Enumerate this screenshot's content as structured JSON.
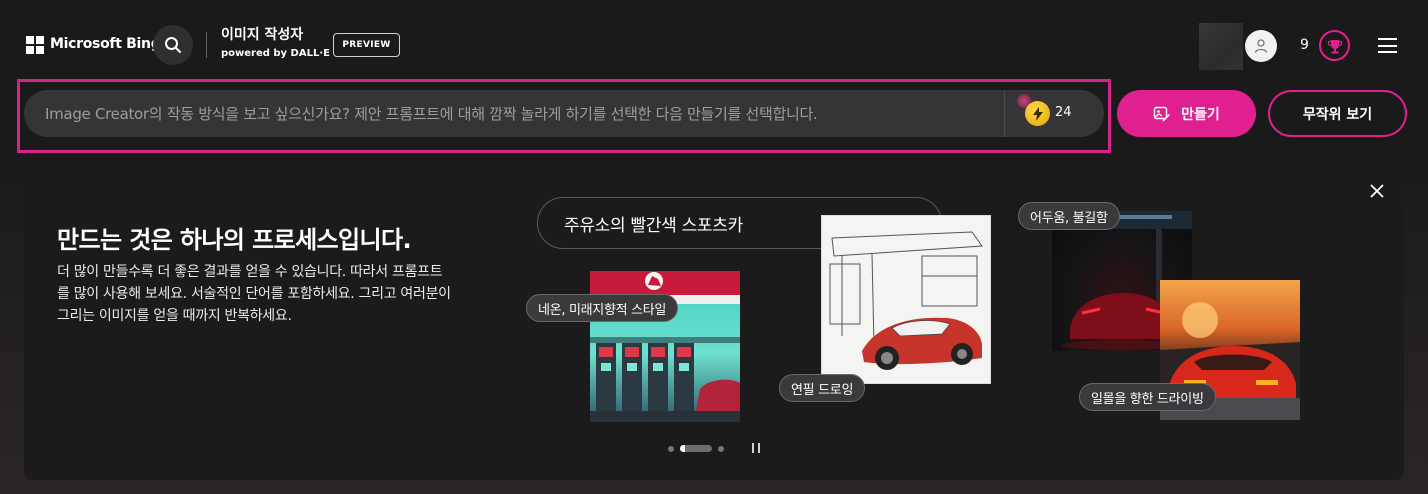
{
  "header": {
    "brand": "Microsoft Bing",
    "app_title": "이미지 작성자",
    "app_subtitle": "powered by DALL·E",
    "badge": "PREVIEW",
    "points": "9",
    "icons": [
      "microsoft-logo",
      "search-icon",
      "user-icon",
      "trophy-icon",
      "hamburger-menu-icon"
    ]
  },
  "prompt": {
    "placeholder": "Image Creator의 작동 방식을 보고 싶으신가요? 제안 프롬프트에 대해 깜짝 놀라게 하기를 선택한 다음 만들기를 선택합니다.",
    "boost_count": "24",
    "create_label": "만들기",
    "surprise_label": "무작위 보기"
  },
  "panel": {
    "title": "만드는 것은 하나의 프로세스입니다.",
    "description": "더 많이 만들수록 더 좋은 결과를 얻을 수 있습니다. 따라서 프롬프트를 많이 사용해 보세요. 서술적인 단어를 포함하세요. 그리고 여러분이 그리는 이미지를 얻을 때까지 반복하세요.",
    "example_prompt": "주유소의 빨간색 스포츠카",
    "tags": {
      "neon": "네온, 미래지향적 스타일",
      "sketch": "연필 드로잉",
      "dark": "어두움, 불길함",
      "sunset": "일몰을 향한 드라이빙"
    }
  },
  "colors": {
    "accent": "#e0208e",
    "background": "#1b1a1b",
    "panel": "#1c1b1c"
  }
}
